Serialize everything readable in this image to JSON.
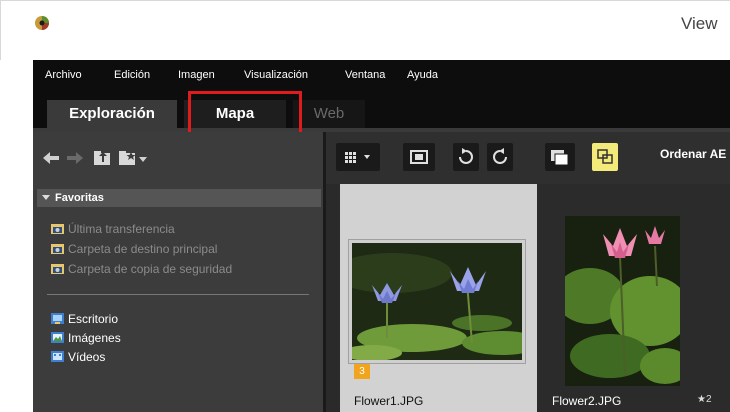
{
  "window": {
    "title": "View"
  },
  "menubar": {
    "items": [
      "Archivo",
      "Edición",
      "Imagen",
      "Visualización",
      "Ventana",
      "Ayuda"
    ]
  },
  "tabs": [
    {
      "label": "Exploración",
      "state": "normal"
    },
    {
      "label": "Mapa",
      "state": "highlighted"
    },
    {
      "label": "Web",
      "state": "disabled"
    }
  ],
  "sidebar": {
    "favorites": {
      "label": "Favoritas",
      "items": [
        {
          "label": "Última transferencia",
          "icon": "folder-camera-icon"
        },
        {
          "label": "Carpeta de destino principal",
          "icon": "folder-camera-icon"
        },
        {
          "label": "Carpeta de copia de seguridad",
          "icon": "folder-camera-icon"
        }
      ]
    },
    "locations": [
      {
        "label": "Escritorio",
        "icon": "desktop-folder-icon"
      },
      {
        "label": "Imágenes",
        "icon": "pictures-folder-icon"
      },
      {
        "label": "Vídeos",
        "icon": "videos-folder-icon"
      }
    ]
  },
  "toolbar": {
    "sort_label": "Ordenar AE"
  },
  "thumbnails": [
    {
      "filename": "Flower1.JPG",
      "rating_badge": "3",
      "selected": true
    },
    {
      "filename": "Flower2.JPG",
      "star": "★2",
      "selected": false
    }
  ],
  "colors": {
    "highlight_border": "#e01b1b",
    "rating_badge": "#f0a51c",
    "sort_button_bg": "#f4ea7a"
  }
}
